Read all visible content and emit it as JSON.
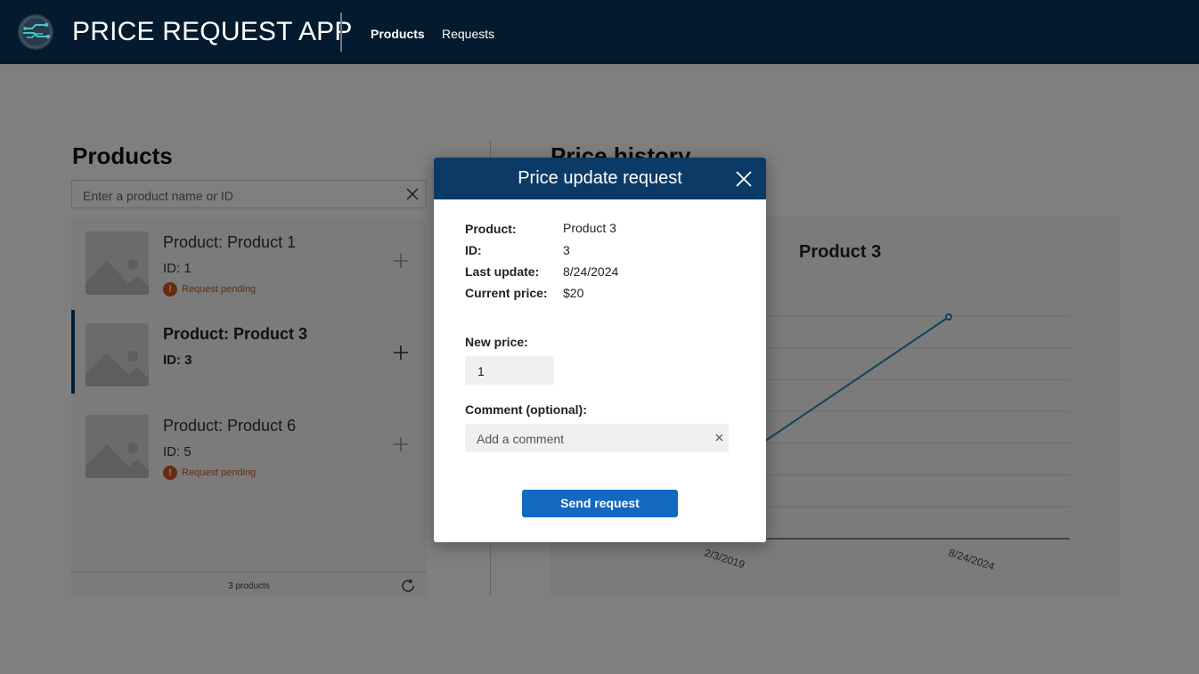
{
  "header": {
    "app_title": "PRICE REQUEST APP",
    "nav": [
      {
        "label": "Products"
      },
      {
        "label": "Requests"
      }
    ]
  },
  "products_section": {
    "title": "Products",
    "search": {
      "placeholder": "Enter a product name or ID",
      "value": ""
    },
    "items": [
      {
        "title": "Product: Product 1",
        "id_label": "ID: 1",
        "status": "Request pending"
      },
      {
        "title": "Product: Product 3",
        "id_label": "ID: 3",
        "status": ""
      },
      {
        "title": "Product: Product 6",
        "id_label": "ID: 5",
        "status": "Request pending"
      }
    ],
    "count_text": "3 products"
  },
  "history_section": {
    "title": "Price history",
    "chart_data": {
      "type": "line",
      "title": "Product 3",
      "categories": [
        "2/3/2019",
        "8/24/2024"
      ],
      "series": [
        {
          "values": [
            null,
            20
          ]
        }
      ]
    }
  },
  "dialog": {
    "title": "Price update request",
    "fields": [
      {
        "label": "Product:",
        "value": "Product 3"
      },
      {
        "label": "ID:",
        "value": "3"
      },
      {
        "label": "Last update:",
        "value": "8/24/2024"
      },
      {
        "label": "Current price:",
        "value": "$20"
      }
    ],
    "new_price_label": "New price:",
    "new_price_value": "1",
    "comment_label": "Comment (optional):",
    "comment_placeholder": "Add a comment",
    "send_label": "Send request"
  },
  "colors": {
    "header_bg": "#041a2e",
    "dialog_header": "#0b3a66",
    "primary_button": "#1269c1",
    "pending": "#c85a1c",
    "chart_line": "#1a86b8"
  }
}
